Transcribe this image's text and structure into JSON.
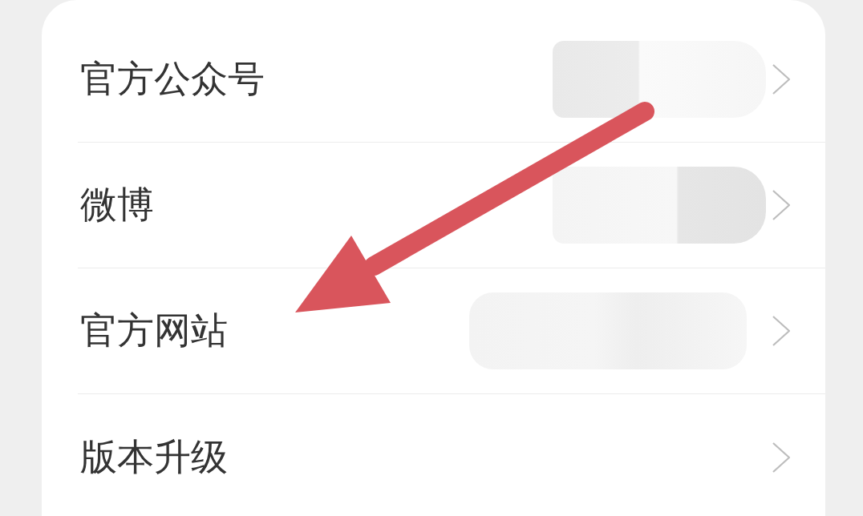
{
  "menu": {
    "items": [
      {
        "label": "官方公众号",
        "blurred_value": true
      },
      {
        "label": "微博",
        "blurred_value": true
      },
      {
        "label": "官方网站",
        "blurred_value": true
      },
      {
        "label": "版本升级",
        "blurred_value": false
      }
    ]
  }
}
